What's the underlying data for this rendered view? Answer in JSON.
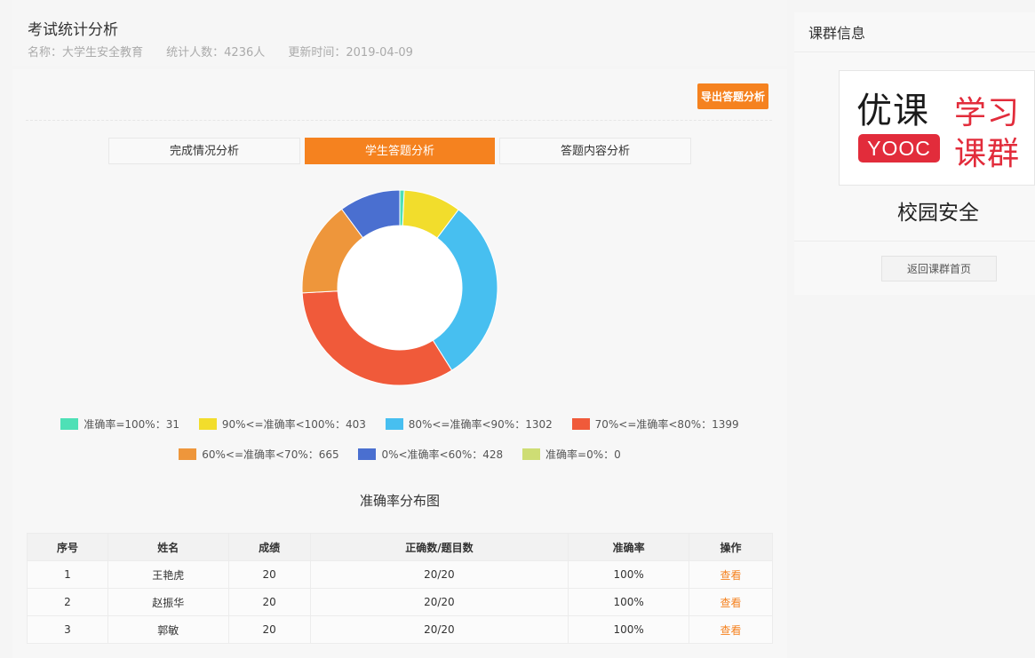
{
  "header": {
    "title": "考试统计分析",
    "name": "名称：大学生安全教育",
    "count": "统计人数：4236人",
    "updated": "更新时间：2019-04-09"
  },
  "toolbar": {
    "export_label": "导出答题分析"
  },
  "tabs": [
    {
      "label": "完成情况分析",
      "active": false
    },
    {
      "label": "学生答题分析",
      "active": true
    },
    {
      "label": "答题内容分析",
      "active": false
    }
  ],
  "chart_data": {
    "type": "pie",
    "donut": true,
    "title": "准确率分布图",
    "legend_position": "bottom",
    "series": [
      {
        "name": "准确率=100%：31",
        "value": 31,
        "color": "#4ee0b6"
      },
      {
        "name": "90%<=准确率<100%：403",
        "value": 403,
        "color": "#f2dd2c"
      },
      {
        "name": "80%<=准确率<90%：1302",
        "value": 1302,
        "color": "#47bff0"
      },
      {
        "name": "70%<=准确率<80%：1399",
        "value": 1399,
        "color": "#f05a3a"
      },
      {
        "name": "60%<=准确率<70%：665",
        "value": 665,
        "color": "#ee963b"
      },
      {
        "name": "0%<准确率<60%：428",
        "value": 428,
        "color": "#4a6fd0"
      },
      {
        "name": "准确率=0%：0",
        "value": 0,
        "color": "#cedd74"
      }
    ]
  },
  "table": {
    "columns": [
      "序号",
      "姓名",
      "成绩",
      "正确数/题目数",
      "准确率",
      "操作"
    ],
    "rows": [
      [
        "1",
        "王艳虎",
        "20",
        "20/20",
        "100%",
        "查看"
      ],
      [
        "2",
        "赵振华",
        "20",
        "20/20",
        "100%",
        "查看"
      ],
      [
        "3",
        "郭敏",
        "20",
        "20/20",
        "100%",
        "查看"
      ]
    ]
  },
  "sidebar": {
    "title": "课群信息",
    "logo": {
      "left_text": "优课",
      "badge": "YOOC",
      "right_top": "学习",
      "right_bottom": "课群"
    },
    "group_name": "校园安全",
    "back_label": "返回课群首页"
  },
  "colors": {
    "accent": "#f5821f",
    "brand_red": "#e22c3b"
  }
}
